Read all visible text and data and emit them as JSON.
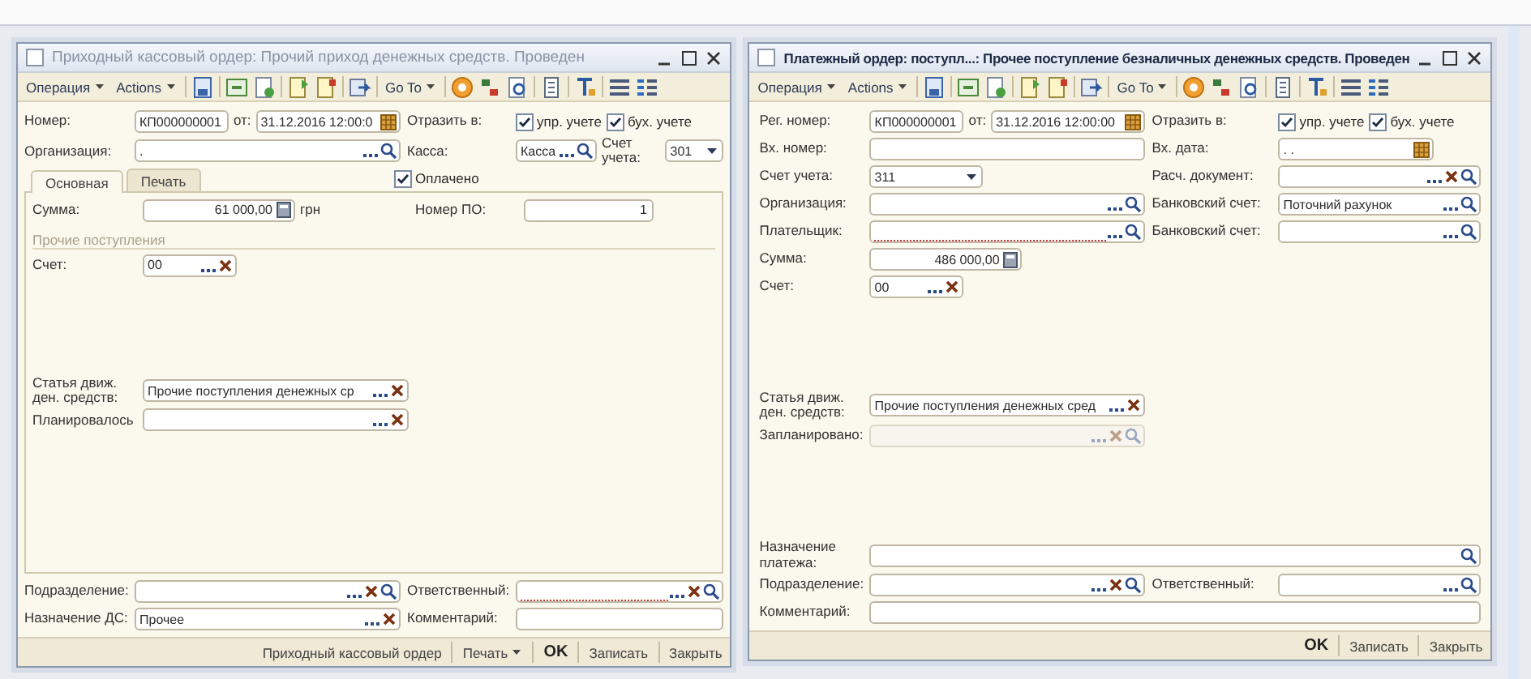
{
  "windows": [
    {
      "title": "Приходный кассовый ордер: Прочий приход денежных средств. Проведен",
      "active": false,
      "toolbar": [
        {
          "kind": "menu",
          "label": "Операция"
        },
        {
          "kind": "menu",
          "label": "Actions"
        },
        {
          "kind": "separator"
        },
        {
          "kind": "tool"
        },
        {
          "kind": "separator"
        },
        {
          "kind": "tool"
        },
        {
          "kind": "tool"
        },
        {
          "kind": "separator"
        },
        {
          "kind": "tool"
        },
        {
          "kind": "tool"
        },
        {
          "kind": "separator"
        },
        {
          "kind": "tool"
        },
        {
          "kind": "separator"
        },
        {
          "kind": "menu",
          "label": "Go To"
        },
        {
          "kind": "separator"
        },
        {
          "kind": "tool"
        },
        {
          "kind": "tool"
        },
        {
          "kind": "tool"
        },
        {
          "kind": "separator"
        },
        {
          "kind": "tool"
        },
        {
          "kind": "separator"
        },
        {
          "kind": "tool"
        },
        {
          "kind": "separator"
        },
        {
          "kind": "tool"
        },
        {
          "kind": "tool"
        }
      ],
      "sections": [
        {
          "kind": "rows",
          "rows": [
            {
              "kind": "fields",
              "label": "Номер:",
              "controls": [
                {
                  "kind": "short",
                  "value": "КП000000001",
                  "picker": false,
                  "clearable": false,
                  "searchable": false
                },
                {
                  "kind": "label",
                  "text": "от:"
                },
                {
                  "kind": "date",
                  "value": "31.12.2016 12:00:0",
                  "picker": false,
                  "clearable": false,
                  "searchable": false
                }
              ],
              "side": {
                "label": "Отразить в:",
                "controls": [
                  {
                    "kind": "check",
                    "label": "упр. учете",
                    "checked": true
                  },
                  {
                    "kind": "check",
                    "label": "бух. учете",
                    "checked": true
                  }
                ]
              }
            },
            {
              "kind": "fields",
              "label": "Организация:",
              "controls": [
                {
                  "kind": "text",
                  "value": ".",
                  "picker": true,
                  "clearable": false,
                  "searchable": true
                }
              ],
              "side": {
                "label": "Касса:",
                "controls": [
                  {
                    "kind": "text",
                    "value": "Касса",
                    "picker": true,
                    "clearable": false,
                    "searchable": true
                  },
                  {
                    "kind": "label",
                    "text": "Счет учета:"
                  },
                  {
                    "kind": "select",
                    "value": "301",
                    "picker": false,
                    "clearable": false,
                    "searchable": false
                  }
                ]
              }
            }
          ]
        },
        {
          "kind": "tabbed",
          "tabs": [
            {
              "label": "Основная",
              "selected": true
            },
            {
              "label": "Печать",
              "selected": false
            }
          ],
          "controls": [
            {
              "kind": "check",
              "label": "Оплачено",
              "checked": true
            }
          ],
          "groups": [
            {
              "rows": [
                {
                  "kind": "fields",
                  "label": "Сумма:",
                  "controls": [
                    {
                      "kind": "amount",
                      "value": "61 000,00",
                      "picker": false,
                      "clearable": false,
                      "searchable": false
                    },
                    {
                      "kind": "unit",
                      "text": "грн"
                    }
                  ],
                  "side": {
                    "label": "Номер ПО:",
                    "controls": [
                      {
                        "kind": "number",
                        "value": "1",
                        "picker": false,
                        "clearable": false,
                        "searchable": false
                      }
                    ]
                  }
                },
                {
                  "kind": "heading",
                  "text": "Прочие поступления"
                },
                {
                  "kind": "fields",
                  "label": "Счет:",
                  "controls": [
                    {
                      "kind": "short",
                      "value": "00",
                      "picker": true,
                      "clearable": true,
                      "searchable": false
                    }
                  ]
                }
              ]
            },
            {
              "rows": [
                {
                  "kind": "fields",
                  "label": "Статья движ. ден. средств:",
                  "controls": [
                    {
                      "kind": "text",
                      "value": "Прочие поступления денежных ср",
                      "picker": true,
                      "clearable": true,
                      "searchable": false
                    }
                  ]
                },
                {
                  "kind": "fields",
                  "label": "Планировалось",
                  "controls": [
                    {
                      "kind": "text",
                      "picker": true,
                      "clearable": true,
                      "searchable": false
                    }
                  ]
                }
              ]
            }
          ]
        },
        {
          "kind": "rows",
          "rows": [
            {
              "kind": "fields",
              "label": "Подразделение:",
              "controls": [
                {
                  "kind": "text",
                  "picker": true,
                  "clearable": true,
                  "searchable": true
                }
              ],
              "side": {
                "label": "Ответственный:",
                "controls": [
                  {
                    "kind": "text",
                    "error": true,
                    "picker": true,
                    "clearable": true,
                    "searchable": true
                  }
                ]
              }
            },
            {
              "kind": "fields",
              "label": "Назначение ДС:",
              "controls": [
                {
                  "kind": "text",
                  "value": "Прочее",
                  "picker": true,
                  "clearable": true,
                  "searchable": false
                }
              ],
              "side": {
                "label": "Комментарий:",
                "controls": [
                  {
                    "kind": "text",
                    "picker": false,
                    "clearable": false,
                    "searchable": false
                  }
                ]
              }
            }
          ]
        }
      ],
      "footer": [
        {
          "kind": "button",
          "label": "Приходный кассовый ордер"
        },
        {
          "kind": "menu",
          "label": "Печать"
        },
        {
          "kind": "default",
          "label": "OK"
        },
        {
          "kind": "button",
          "label": "Записать"
        },
        {
          "kind": "button",
          "label": "Закрыть"
        }
      ]
    },
    {
      "title": "Платежный ордер: поступл...: Прочее поступление безналичных денежных средств. Проведен",
      "active": true,
      "toolbar": [
        {
          "kind": "menu",
          "label": "Операция"
        },
        {
          "kind": "menu",
          "label": "Actions"
        },
        {
          "kind": "separator"
        },
        {
          "kind": "tool"
        },
        {
          "kind": "separator"
        },
        {
          "kind": "tool"
        },
        {
          "kind": "tool"
        },
        {
          "kind": "separator"
        },
        {
          "kind": "tool"
        },
        {
          "kind": "tool"
        },
        {
          "kind": "separator"
        },
        {
          "kind": "tool"
        },
        {
          "kind": "separator"
        },
        {
          "kind": "menu",
          "label": "Go To"
        },
        {
          "kind": "separator"
        },
        {
          "kind": "tool"
        },
        {
          "kind": "tool"
        },
        {
          "kind": "tool"
        },
        {
          "kind": "separator"
        },
        {
          "kind": "tool"
        },
        {
          "kind": "separator"
        },
        {
          "kind": "tool"
        },
        {
          "kind": "separator"
        },
        {
          "kind": "tool"
        },
        {
          "kind": "tool"
        }
      ],
      "sections": [
        {
          "kind": "rows",
          "rows": [
            {
              "kind": "fields",
              "label": "Рег. номер:",
              "controls": [
                {
                  "kind": "short",
                  "value": "КП000000001",
                  "picker": false,
                  "clearable": false,
                  "searchable": false
                },
                {
                  "kind": "label",
                  "text": "от:"
                },
                {
                  "kind": "date",
                  "value": "31.12.2016 12:00:00",
                  "picker": false,
                  "clearable": false,
                  "searchable": false
                }
              ],
              "side": {
                "label": "Отразить в:",
                "controls": [
                  {
                    "kind": "check",
                    "label": "упр. учете",
                    "checked": true
                  },
                  {
                    "kind": "check",
                    "label": "бух. учете",
                    "checked": true
                  }
                ]
              }
            },
            {
              "kind": "fields",
              "label": "Вх. номер:",
              "controls": [
                {
                  "kind": "text",
                  "picker": false,
                  "clearable": false,
                  "searchable": false
                }
              ],
              "side": {
                "label": "Вх. дата:",
                "controls": [
                  {
                    "kind": "date",
                    "value": ". .",
                    "picker": false,
                    "clearable": false,
                    "searchable": false
                  }
                ]
              }
            },
            {
              "kind": "fields",
              "label": "Счет учета:",
              "controls": [
                {
                  "kind": "select",
                  "value": "311",
                  "picker": false,
                  "clearable": false,
                  "searchable": false
                }
              ],
              "side": {
                "label": "Расч. документ:",
                "controls": [
                  {
                    "kind": "text",
                    "picker": true,
                    "clearable": true,
                    "searchable": true
                  }
                ]
              }
            },
            {
              "kind": "fields",
              "label": "Организация:",
              "controls": [
                {
                  "kind": "text",
                  "picker": true,
                  "clearable": false,
                  "searchable": true
                }
              ],
              "side": {
                "label": "Банковский счет:",
                "controls": [
                  {
                    "kind": "text",
                    "value": "Поточний рахунок",
                    "picker": true,
                    "clearable": false,
                    "searchable": true
                  }
                ]
              }
            },
            {
              "kind": "fields",
              "label": "Плательщик:",
              "controls": [
                {
                  "kind": "text",
                  "error": true,
                  "picker": true,
                  "clearable": false,
                  "searchable": true
                }
              ],
              "side": {
                "label": "Банковский счет:",
                "controls": [
                  {
                    "kind": "text",
                    "picker": true,
                    "clearable": false,
                    "searchable": true
                  }
                ]
              }
            },
            {
              "kind": "fields",
              "label": "Сумма:",
              "controls": [
                {
                  "kind": "amount",
                  "value": "486 000,00",
                  "picker": false,
                  "clearable": false,
                  "searchable": false
                }
              ]
            },
            {
              "kind": "fields",
              "label": "Счет:",
              "controls": [
                {
                  "kind": "short",
                  "value": "00",
                  "picker": true,
                  "clearable": true,
                  "searchable": false
                }
              ]
            }
          ]
        },
        {
          "kind": "rows",
          "rows": [
            {
              "kind": "fields",
              "label": "Статья движ. ден. средств:",
              "controls": [
                {
                  "kind": "text",
                  "value": "Прочие поступления денежных сред",
                  "picker": true,
                  "clearable": true,
                  "searchable": false
                }
              ]
            },
            {
              "kind": "fields",
              "label": "Запланировано:",
              "controls": [
                {
                  "kind": "text",
                  "disabled": true,
                  "picker": true,
                  "clearable": true,
                  "searchable": true
                }
              ]
            }
          ]
        },
        {
          "kind": "rows",
          "rows": [
            {
              "kind": "wide",
              "label": "Назначение платежа:",
              "controls": [
                {
                  "kind": "text",
                  "picker": false,
                  "clearable": false,
                  "searchable": true
                }
              ]
            },
            {
              "kind": "fields",
              "label": "Подразделение:",
              "controls": [
                {
                  "kind": "text",
                  "picker": true,
                  "clearable": true,
                  "searchable": true
                }
              ],
              "side": {
                "label": "Ответственный:",
                "controls": [
                  {
                    "kind": "text",
                    "picker": true,
                    "clearable": false,
                    "searchable": true
                  }
                ]
              }
            },
            {
              "kind": "wide",
              "label": "Комментарий:",
              "controls": [
                {
                  "kind": "text",
                  "picker": false,
                  "clearable": false,
                  "searchable": false
                }
              ]
            }
          ]
        }
      ],
      "footer": [
        {
          "kind": "default",
          "label": "OK"
        },
        {
          "kind": "button",
          "label": "Записать"
        },
        {
          "kind": "button",
          "label": "Закрыть"
        }
      ]
    }
  ]
}
